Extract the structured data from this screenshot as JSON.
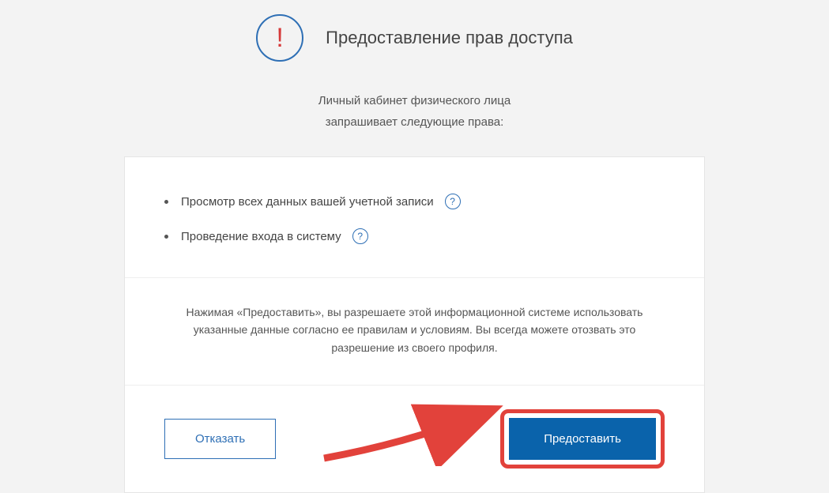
{
  "header": {
    "title": "Предоставление прав доступа"
  },
  "subtitle": {
    "line1": "Личный кабинет физического лица",
    "line2": "запрашивает следующие права:"
  },
  "permissions": [
    {
      "label": "Просмотр всех данных вашей учетной записи"
    },
    {
      "label": "Проведение входа в систему"
    }
  ],
  "notice": "Нажимая «Предоставить», вы разрешаете этой информационной системе использовать указанные данные согласно ее правилам и условиям. Вы всегда можете отозвать это разрешение из своего профиля.",
  "actions": {
    "decline_label": "Отказать",
    "grant_label": "Предоставить"
  }
}
